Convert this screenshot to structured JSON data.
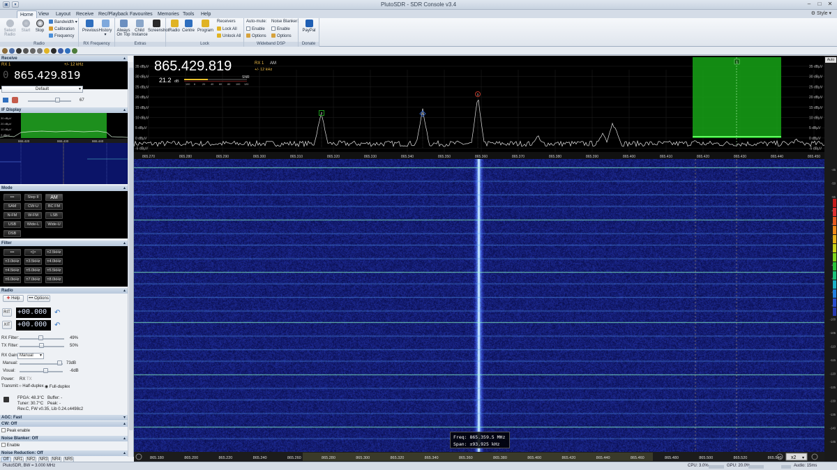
{
  "window": {
    "title": "PlutoSDR - SDR Console v3.4",
    "style_label": "Style"
  },
  "ribbon_tabs": [
    "Home",
    "View",
    "Layout",
    "Receive",
    "Rec/Playback",
    "Favourites",
    "Memories",
    "Tools",
    "Help"
  ],
  "ribbon": {
    "radio_group": {
      "label": "Radio",
      "select_radio": "Select Radio",
      "start": "Start",
      "stop": "Stop",
      "bandwidth": "Bandwidth",
      "calibration": "Calibration",
      "frequency": "Frequency"
    },
    "rx_group": {
      "label": "RX Frequency",
      "previous": "Previous",
      "history": "History"
    },
    "extras_group": {
      "label": "Extras",
      "always_on_top": "Always On Top",
      "child_instance": "Child Instance",
      "screenshot": "Screenshot"
    },
    "lock_group": {
      "label": "Lock",
      "radio": "Radio",
      "centre": "Centre",
      "program": "Program",
      "receivers": "Receivers",
      "lock_all": "Lock All",
      "unlock_all": "Unlock All"
    },
    "dsp_group": {
      "label": "Wideband DSP",
      "auto_mute": "Auto-mute:",
      "enable1": "Enable",
      "options1": "Options",
      "noise_blanker": "Noise Blanker:",
      "enable2": "Enable",
      "options2": "Options"
    },
    "donate_group": {
      "label": "Donate",
      "paypal": "PayPal"
    }
  },
  "left_panel": {
    "receive_header": "Receive",
    "rx_label": "RX 1",
    "rx_bw": "+/- 12 kHz",
    "frequency": "865.429.819",
    "frequency_prefix": "0",
    "preset": "Default",
    "volume": "67",
    "if_display_header": "IF Display",
    "if_ticks": [
      "865.420",
      "865.430",
      "865.440"
    ],
    "if_db_labels": [
      "30 dBµV",
      "20 dBµV",
      "10 dBµV",
      "0 dBµV"
    ],
    "mode_header": "Mode",
    "mode_buttons": [
      "•••",
      "Step II",
      "AM",
      "SAM",
      "CW-U",
      "BC FM",
      "N-FM",
      "W-FM",
      "LSB",
      "USB",
      "Wide-L",
      "Wide-U",
      "DSB"
    ],
    "filter_header": "Filter",
    "filter_buttons": [
      "•••",
      "<|>",
      "±2.5kHz",
      "±3.0kHz",
      "±3.5kHz",
      "±4.0kHz",
      "±4.5kHz",
      "±5.0kHz",
      "±5.5kHz",
      "±6.0kHz",
      "±7.0kHz",
      "±8.0kHz"
    ],
    "radio_header": "Radio",
    "help_btn": "Help",
    "options_btn": "Options",
    "rit_label": "RIT",
    "xit_label": "XIT",
    "rit_value": "+00.000",
    "xit_value": "+00.000",
    "rx_filter_label": "RX Filter:",
    "rx_filter_value": "49%",
    "tx_filter_label": "TX Filter:",
    "tx_filter_value": "50%",
    "rx_gain_label": "RX Gain:",
    "rx_gain_value": "Manual",
    "manual_label": "Manual:",
    "manual_value": "73dB",
    "visual_label": "Visual:",
    "visual_value": "-6dB",
    "power_label": "Power:",
    "power_rx": "RX",
    "power_tx": "TX",
    "transmit_label": "Transmit:",
    "half_duplex": "Half-duplex",
    "full_duplex": "Full-duplex",
    "fpga": "FPGA: 48.3°C",
    "buffer": "Buffer: -",
    "tuner": "Tuner: 30.7°C",
    "peak": "Peak: -",
    "rev": "Rev.C, FW v0.35, Lib 0.24.c4498c2",
    "agc_header": "AGC: Fast",
    "cw_header": "CW: Off",
    "peak_enable": "Peak enable",
    "nb_header": "Noise Blanker: Off",
    "nb_enable": "Enable",
    "nr_header": "Noise Reduction: Off",
    "nr_buttons": [
      "Off",
      "NR1",
      "NR2",
      "NR3",
      "NR4",
      "NR5"
    ]
  },
  "spectrum": {
    "frequency": "865.429.819",
    "rx_label": "RX 1",
    "mode": "AM",
    "bw": "+/- 12 kHz",
    "snr_value": "21.2",
    "snr_unit": "dB",
    "snr_label": "SNR",
    "snr_ticks": [
      "100",
      "6",
      "20",
      "40",
      "60",
      "80",
      "100",
      "120"
    ],
    "db_labels": [
      "35 dBµV",
      "30 dBµV",
      "25 dBµV",
      "20 dBµV",
      "15 dBµV",
      "10 dBµV",
      "5 dBµV",
      "0 dBµV",
      "-5 dBµV"
    ],
    "freq_ticks": [
      "865.270",
      "865.280",
      "865.290",
      "865.300",
      "865.310",
      "865.320",
      "865.330",
      "865.340",
      "865.350",
      "865.360",
      "865.370",
      "865.380",
      "865.390",
      "865.400",
      "865.410",
      "865.420",
      "865.430",
      "865.440",
      "865.450"
    ],
    "markers": [
      "2",
      "1",
      "1",
      "1"
    ],
    "auto_label": "Auto"
  },
  "waterfall": {
    "tooltip_freq": "Freq:  865.359.5 MHz",
    "tooltip_span": "Span:   ±93.925 kHz",
    "scale_ticks": [
      "865.180",
      "865.200",
      "865.220",
      "865.240",
      "865.260",
      "865.280",
      "865.300",
      "865.320",
      "865.340",
      "865.360",
      "865.380",
      "865.400",
      "865.420",
      "865.440",
      "865.460",
      "865.480",
      "865.500",
      "865.520",
      "865.540"
    ],
    "zoom_label": "x2",
    "right_db_labels": [
      "-45",
      "-50",
      "-55",
      "-60",
      "-65",
      "-70",
      "-75",
      "-80",
      "-85",
      "-90",
      "-95",
      "-100",
      "-105",
      "-110",
      "-115",
      "-120",
      "-125",
      "-130",
      "-135",
      "-140",
      "-145"
    ]
  },
  "statusbar": {
    "left": "PlutoSDR, BW = 3.000 MHz",
    "cpu": "CPU: 3.0%",
    "gpu": "GPU: 20.0%",
    "audio": "Audio: 15ms"
  },
  "colors": {
    "accent": "#0a0f5c",
    "peak": "#6fbfff",
    "green_band": "#19a019"
  }
}
